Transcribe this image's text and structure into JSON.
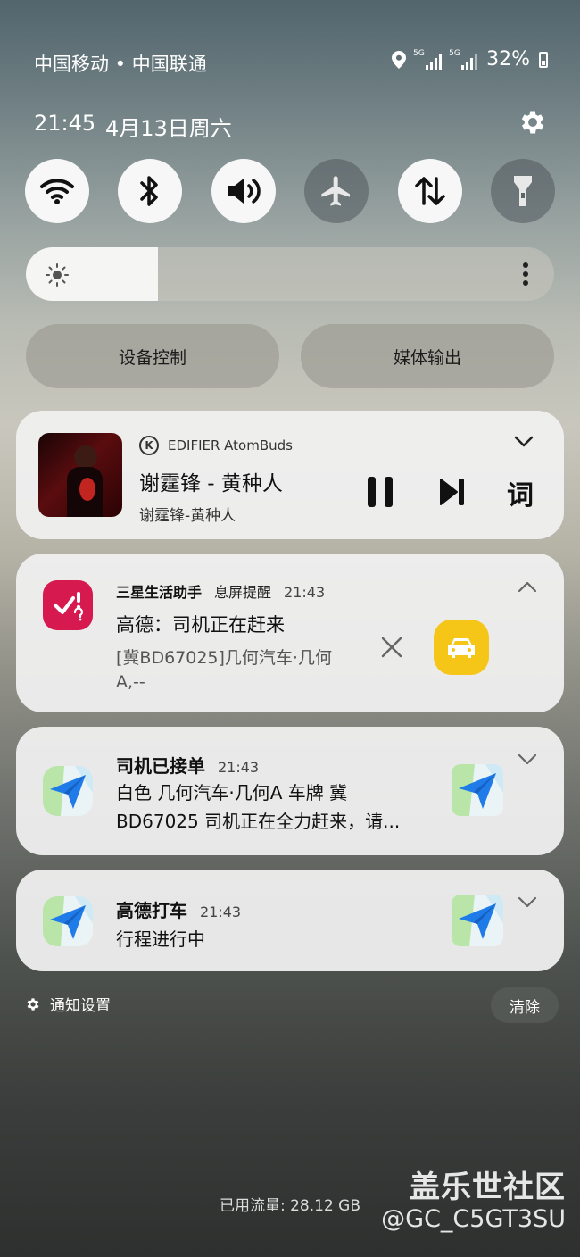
{
  "status_bar": {
    "carrier": "中国移动 • 中国联通",
    "net1_label": "5G",
    "net2_label": "5G",
    "battery": "32%",
    "icons": [
      "location-icon",
      "signal-icon",
      "signal-icon",
      "battery-icon"
    ]
  },
  "header": {
    "time": "21:45",
    "date": "4月13日周六"
  },
  "quick_toggles": [
    {
      "name": "wifi",
      "state": "on"
    },
    {
      "name": "bluetooth",
      "state": "on"
    },
    {
      "name": "sound",
      "state": "on"
    },
    {
      "name": "airplane-mode",
      "state": "off"
    },
    {
      "name": "mobile-data",
      "state": "on"
    },
    {
      "name": "flashlight",
      "state": "off"
    }
  ],
  "brightness": {
    "level": 0.25
  },
  "buttons": {
    "device_control": "设备控制",
    "media_output": "媒体输出"
  },
  "media": {
    "source": "EDIFIER AtomBuds",
    "source_badge": "K",
    "title": "谢霆锋 - 黄种人",
    "subtitle": "谢霆锋-黄种人",
    "lyrics_label": "词",
    "state": "playing"
  },
  "notifications": [
    {
      "app": "三星生活助手",
      "channel": "息屏提醒",
      "time": "21:43",
      "title": "高德：司机正在赶来",
      "body": "[冀BD67025]几何汽车·几何A,--",
      "colors": {
        "icon_bg": "#d6194e",
        "action_bg": "#f5c518"
      }
    },
    {
      "app": "司机已接单",
      "time": "21:43",
      "body": "白色 几何汽车·几何A 车牌 冀BD67025 司机正在全力赶来，请..."
    },
    {
      "app": "高德打车",
      "time": "21:43",
      "body": "行程进行中"
    }
  ],
  "footer": {
    "notification_settings": "通知设置",
    "clear": "清除",
    "data_usage": "已用流量: 28.12 GB",
    "watermark_line1": "盖乐世社区",
    "watermark_line2": "@GC_C5GT3SU"
  }
}
